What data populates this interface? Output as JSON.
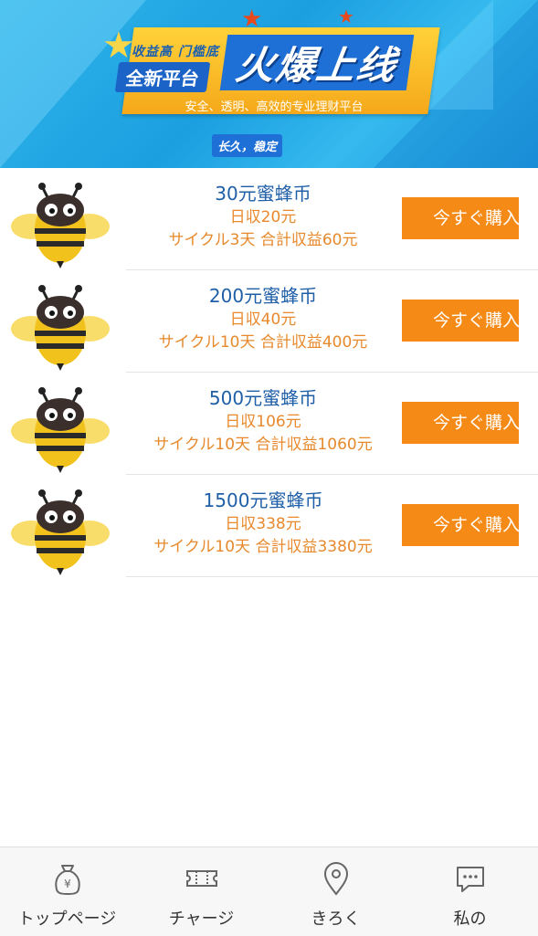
{
  "banner": {
    "tag_small": "收益高 门槛底",
    "tag_plate": "全新平台",
    "title": "火爆上线",
    "subtitle": "安全、透明、高效的专业理财平台",
    "badge": "长久，稳定"
  },
  "products": [
    {
      "name": "30元蜜蜂币",
      "daily": "日収20元",
      "cycle": "サイクル3天 合計収益60元",
      "buy_label": "今すぐ購入"
    },
    {
      "name": "200元蜜蜂币",
      "daily": "日収40元",
      "cycle": "サイクル10天 合計収益400元",
      "buy_label": "今すぐ購入"
    },
    {
      "name": "500元蜜蜂币",
      "daily": "日収106元",
      "cycle": "サイクル10天 合計収益1060元",
      "buy_label": "今すぐ購入"
    },
    {
      "name": "1500元蜜蜂币",
      "daily": "日収338元",
      "cycle": "サイクル10天 合計収益3380元",
      "buy_label": "今すぐ購入"
    }
  ],
  "tabbar": {
    "tabs": [
      {
        "label": "トップページ",
        "icon": "money-bag-icon"
      },
      {
        "label": "チャージ",
        "icon": "ticket-icon"
      },
      {
        "label": "きろく",
        "icon": "location-pin-icon"
      },
      {
        "label": "私の",
        "icon": "chat-bubble-icon"
      }
    ]
  },
  "colors": {
    "accent_orange": "#f58a16",
    "product_name_blue": "#1f5fa8",
    "detail_orange": "#e7892c",
    "banner_blue": "#1e9fe0"
  }
}
